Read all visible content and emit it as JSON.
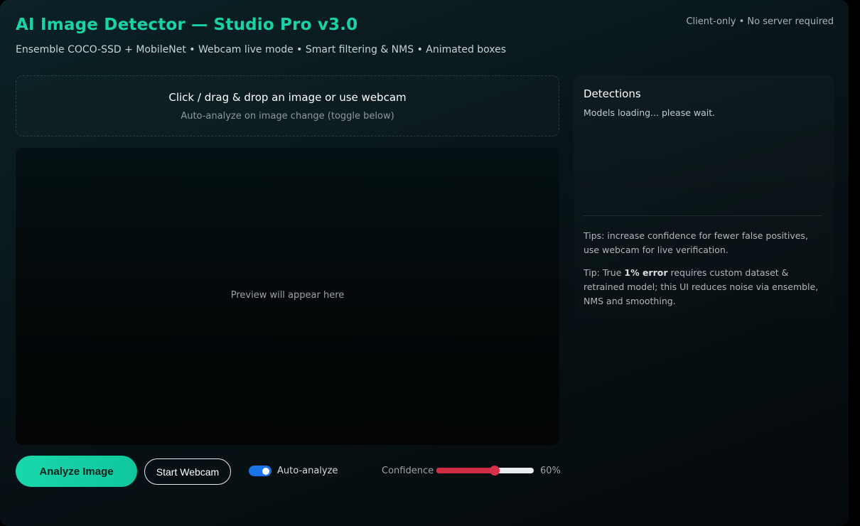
{
  "header": {
    "title": "AI Image Detector — Studio Pro v3.0",
    "subtitle": "Ensemble COCO-SSD + MobileNet • Webcam live mode • Smart filtering & NMS • Animated boxes",
    "meta": "Client-only • No server required"
  },
  "dropzone": {
    "title": "Click / drag & drop an image or use webcam",
    "subtitle": "Auto-analyze on image change (toggle below)"
  },
  "preview": {
    "placeholder": "Preview will appear here"
  },
  "detections": {
    "title": "Detections",
    "status": "Models loading... please wait.",
    "tip1": "Tips: increase confidence for fewer false positives, use webcam for live verification.",
    "tip2_prefix": "Tip: True ",
    "tip2_bold": "1% error",
    "tip2_suffix": " requires custom dataset & retrained model; this UI reduces noise via ensemble, NMS and smoothing."
  },
  "controls": {
    "analyze_label": "Analyze Image",
    "webcam_label": "Start Webcam",
    "auto_analyze_label": "Auto-analyze",
    "auto_analyze_on": true,
    "confidence_label": "Confidence",
    "confidence_value": 60,
    "confidence_display": "60%"
  },
  "colors": {
    "accent": "#19d3a8",
    "toggle": "#1a73e8",
    "slider_fill": "#d12d45"
  }
}
